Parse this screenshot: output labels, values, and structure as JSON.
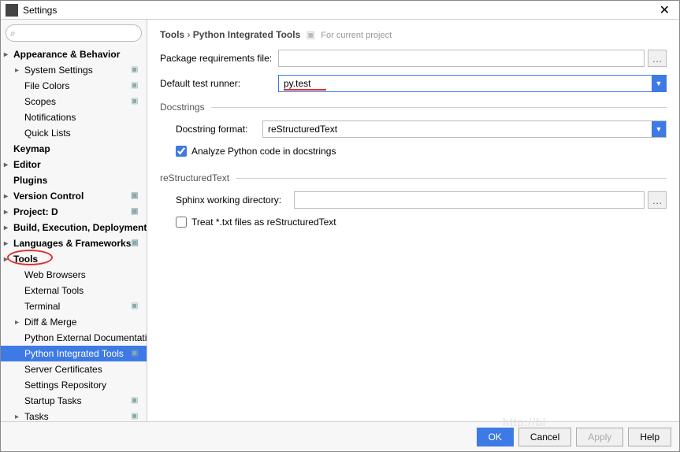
{
  "window": {
    "title": "Settings",
    "close": "✕"
  },
  "search": {
    "placeholder": ""
  },
  "sidebar": {
    "items": [
      {
        "label": "Appearance & Behavior",
        "bold": true,
        "arrow": true
      },
      {
        "label": "System Settings",
        "child": true,
        "arrow": true,
        "badge": true
      },
      {
        "label": "File Colors",
        "child": true,
        "badge": true
      },
      {
        "label": "Scopes",
        "child": true,
        "badge": true
      },
      {
        "label": "Notifications",
        "child": true
      },
      {
        "label": "Quick Lists",
        "child": true
      },
      {
        "label": "Keymap",
        "bold": true
      },
      {
        "label": "Editor",
        "bold": true,
        "arrow": true
      },
      {
        "label": "Plugins",
        "bold": true
      },
      {
        "label": "Version Control",
        "bold": true,
        "arrow": true,
        "badge": true
      },
      {
        "label": "Project: D",
        "bold": true,
        "arrow": true,
        "badge": true
      },
      {
        "label": "Build, Execution, Deployment",
        "bold": true,
        "arrow": true
      },
      {
        "label": "Languages & Frameworks",
        "bold": true,
        "arrow": true,
        "badge": true
      },
      {
        "label": "Tools",
        "bold": true,
        "arrow": true,
        "circled": true
      },
      {
        "label": "Web Browsers",
        "child": true
      },
      {
        "label": "External Tools",
        "child": true
      },
      {
        "label": "Terminal",
        "child": true,
        "badge": true
      },
      {
        "label": "Diff & Merge",
        "child": true,
        "arrow": true
      },
      {
        "label": "Python External Documentatic",
        "child": true
      },
      {
        "label": "Python Integrated Tools",
        "child": true,
        "badge": true,
        "selected": true
      },
      {
        "label": "Server Certificates",
        "child": true
      },
      {
        "label": "Settings Repository",
        "child": true
      },
      {
        "label": "Startup Tasks",
        "child": true,
        "badge": true
      },
      {
        "label": "Tasks",
        "child": true,
        "arrow": true,
        "badge": true
      }
    ]
  },
  "breadcrumb": {
    "root": "Tools",
    "sep": "›",
    "leaf": "Python Integrated Tools",
    "project": "For current project"
  },
  "fields": {
    "package_req_label": "Package requirements file:",
    "package_req_value": "",
    "test_runner_label": "Default test runner:",
    "test_runner_value": "py.test"
  },
  "docstrings": {
    "legend": "Docstrings",
    "format_label": "Docstring format:",
    "format_value": "reStructuredText",
    "analyze_label": "Analyze Python code in docstrings",
    "analyze_checked": true
  },
  "rst": {
    "legend": "reStructuredText",
    "sphinx_label": "Sphinx working directory:",
    "sphinx_value": "",
    "treat_label": "Treat *.txt files as reStructuredText",
    "treat_checked": false
  },
  "footer": {
    "ok": "OK",
    "cancel": "Cancel",
    "apply": "Apply",
    "help": "Help"
  },
  "watermark": "http://bl"
}
